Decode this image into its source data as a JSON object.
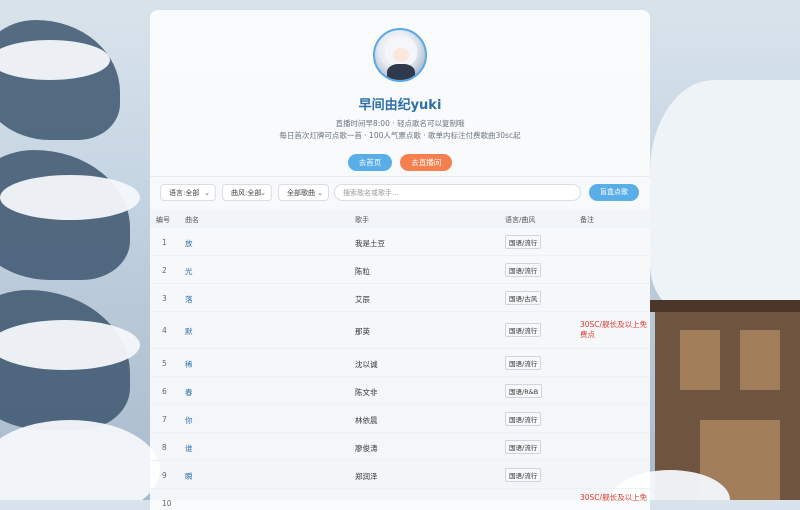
{
  "profile": {
    "name": "早间由纪yuki",
    "subtitle_line1": "直播时间早8:00 · 轻点歌名可以复制哦",
    "subtitle_line2": "每日首次灯牌可点歌一首 · 100人气票点歌 · 歌单内标注付费歌曲30sc起"
  },
  "buttons": {
    "home": "去首页",
    "live": "去直播间"
  },
  "filters": {
    "language": "语言:全部",
    "style": "曲风:全部",
    "category": "全部歌曲",
    "search_placeholder": "搜索歌名或歌手...",
    "random_button": "盲盒点歌"
  },
  "table": {
    "headers": {
      "number": "编号",
      "song": "曲名",
      "singer": "歌手",
      "lang_style": "语言/曲风",
      "note": "备注"
    },
    "rows": [
      {
        "no": "1",
        "song": "放",
        "singer": "我是土豆",
        "tag": "国语/流行",
        "note": ""
      },
      {
        "no": "2",
        "song": "光",
        "singer": "陈粒",
        "tag": "国语/流行",
        "note": ""
      },
      {
        "no": "3",
        "song": "落",
        "singer": "艾辰",
        "tag": "国语/古风",
        "note": ""
      },
      {
        "no": "4",
        "song": "默",
        "singer": "那英",
        "tag": "国语/流行",
        "note": "30SC/舰长及以上免费点"
      },
      {
        "no": "5",
        "song": "稀",
        "singer": "沈以诚",
        "tag": "国语/流行",
        "note": ""
      },
      {
        "no": "6",
        "song": "春",
        "singer": "陈文非",
        "tag": "国语/R&B",
        "note": ""
      },
      {
        "no": "7",
        "song": "你",
        "singer": "林依晨",
        "tag": "国语/流行",
        "note": ""
      },
      {
        "no": "8",
        "song": "谁",
        "singer": "廖俊涛",
        "tag": "国语/流行",
        "note": ""
      },
      {
        "no": "9",
        "song": "瞬",
        "singer": "郑润泽",
        "tag": "国语/流行",
        "note": ""
      },
      {
        "no": "10",
        "song": "",
        "singer": "",
        "tag": "",
        "note": "30SC/舰长及以上免"
      }
    ]
  },
  "colors": {
    "accent_blue": "#5aaee8",
    "accent_orange": "#f4804f",
    "title_blue": "#2f6fa8",
    "note_red": "#e0392c"
  }
}
